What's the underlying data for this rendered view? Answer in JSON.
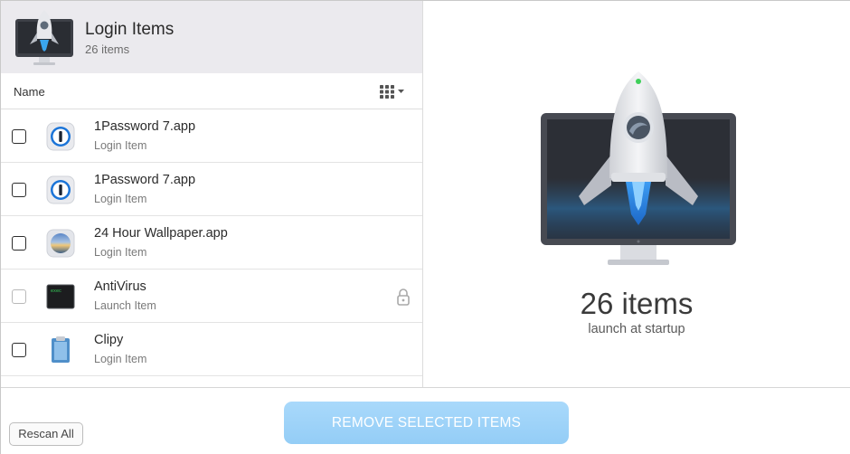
{
  "header": {
    "title": "Login Items",
    "subtitle": "26 items",
    "logo_icon": "rocket-monitor-icon"
  },
  "list": {
    "column_name": "Name",
    "view_toggle_icon": "grid-view-icon",
    "items": [
      {
        "name": "1Password 7.app",
        "kind": "Login Item",
        "icon": "1password-icon",
        "checked": false,
        "locked": false
      },
      {
        "name": "1Password 7.app",
        "kind": "Login Item",
        "icon": "1password-icon",
        "checked": false,
        "locked": false
      },
      {
        "name": "24 Hour Wallpaper.app",
        "kind": "Login Item",
        "icon": "wallpaper-icon",
        "checked": false,
        "locked": false
      },
      {
        "name": "AntiVirus",
        "kind": "Launch Item",
        "icon": "terminal-icon",
        "checked": false,
        "locked": true
      },
      {
        "name": "Clipy",
        "kind": "Login Item",
        "icon": "clipboard-icon",
        "checked": false,
        "locked": false
      }
    ]
  },
  "summary": {
    "count": "26 items",
    "caption": "launch at startup"
  },
  "footer": {
    "rescan_label": "Rescan All",
    "remove_label": "REMOVE SELECTED ITEMS"
  },
  "colors": {
    "remove_button": "#9fd4f9",
    "header_bg": "#ebeaee"
  }
}
